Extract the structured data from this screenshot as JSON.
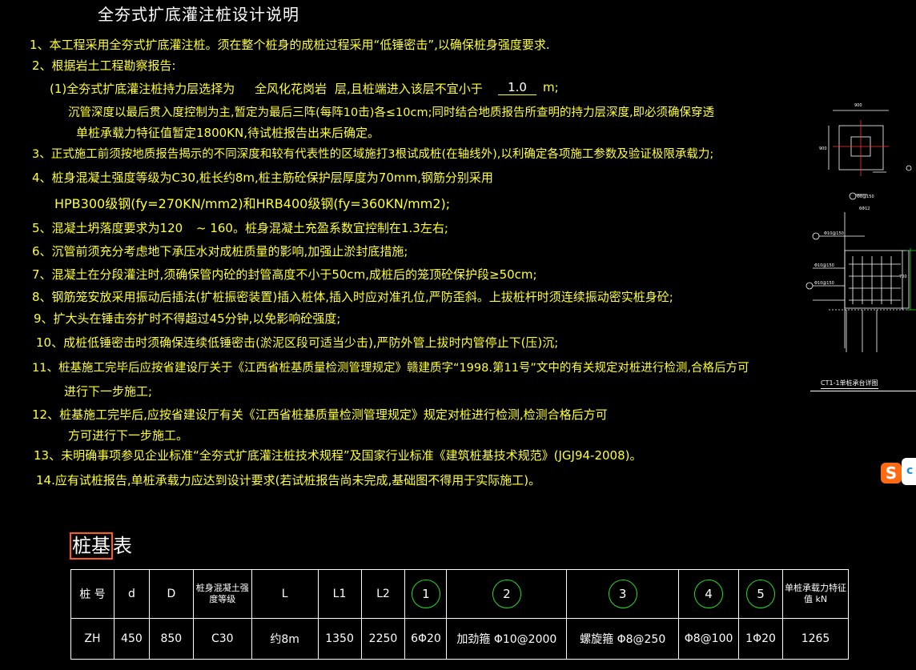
{
  "title": "全夯式扩底灌注桩设计说明",
  "notes": [
    "1、本工程采用全夯式扩底灌注桩。须在整个桩身的成桩过程采用“低锤密击”,以确保桩身强度要求.",
    "2、根据岩土工程勘察报告:",
    "(1)全夯式扩底灌注桩持力层选择为",
    "全风化花岗岩",
    "层,且桩端进入该层不宜小于",
    "1.0",
    "m;",
    "沉管深度以最后贯入度控制为主,暂定为最后三阵(每阵10击)各≤10cm;同时结合地质报告所查明的持力层深度,即必须确保穿透",
    "单桩承载力特征值暂定1800KN,待试桩报告出来后确定。",
    "3、正式施工前须按地质报告揭示的不同深度和较有代表性的区域施打3根试成桩(在轴线外),以利确定各项施工参数及验证极限承载力;",
    "4、桩身混凝土强度等级为C30,桩长约8m,桩主筋砼保护层厚度为70mm,钢筋分别采用",
    "HPB300级钢(fy=270KN/mm2)和HRB400级钢(fy=360KN/mm2);",
    "5、混凝土坍落度要求为120",
    "~  160。桩身混凝土充盈系数宜控制在1.3左右;",
    "6、沉管前须充分考虑地下承压水对成桩质量的影响,加强止淤封底措施;",
    "7、混凝土在分段灌注时,须确保管内砼的封管高度不小于50cm,成桩后的笼顶砼保护段≥50cm;",
    "8、钢筋笼安放采用振动后插法(扩桩振密装置)插入桩体,插入时应对准孔位,严防歪斜。上拔桩杆时须连续振动密实桩身砼;",
    "9、扩大头在锤击夯扩时不得超过45分钟,以免影响砼强度;",
    "10、成桩低锤密击时须确保连续低锤密击(淤泥区段可适当少击),严防外管上拔时内管停止下(压)沉;",
    "11、桩基施工完毕后应按省建设厅关于《江西省桩基质量检测管理规定》赣建质字“1998.第11号”文中的有关规定对桩进行检测,合格后方可",
    "进行下一步施工;",
    "12、桩基施工完毕后,应按省建设厅有关《江西省桩基质量检测管理规定》规定对桩进行检测,检测合格后方可",
    "方可进行下一步施工。",
    "13、未明确事项参见企业标准“全夯式扩底灌注桩技术规程”及国家行业标准《建筑桩基技术规范》(JGJ94-2008)。",
    "14.应有试桩报告,单桩承载力应达到设计要求(若试桩报告尚未完成,基础图不得用于实际施工)。"
  ],
  "detail": {
    "caption": "CT1-1单桩承台详图",
    "dim_top": "900",
    "dim_side": "900",
    "dim_lower": "700",
    "labels": [
      "Φ8@150",
      "Φ10@150",
      "6Φ12",
      "Φ10@150",
      "Φ10@150",
      "Φ10@150",
      "Φ10@150"
    ]
  },
  "sogou": {
    "letter": "S"
  },
  "pile_table": {
    "title_boxed": "桩基",
    "title_rest": "表",
    "headers": [
      "桩 号",
      "d",
      "D",
      "桩身混凝土强度等级",
      "L",
      "L1",
      "L2",
      "1",
      "2",
      "3",
      "4",
      "5",
      "单桩承载力特征值 kN"
    ],
    "row": [
      "ZH",
      "450",
      "850",
      "C30",
      "约8m",
      "1350",
      "2250",
      "6Φ20",
      "加劲箍   Φ10@2000",
      "螺旋箍  Φ8@250",
      "Φ8@100",
      "1Φ20",
      "1265"
    ]
  }
}
